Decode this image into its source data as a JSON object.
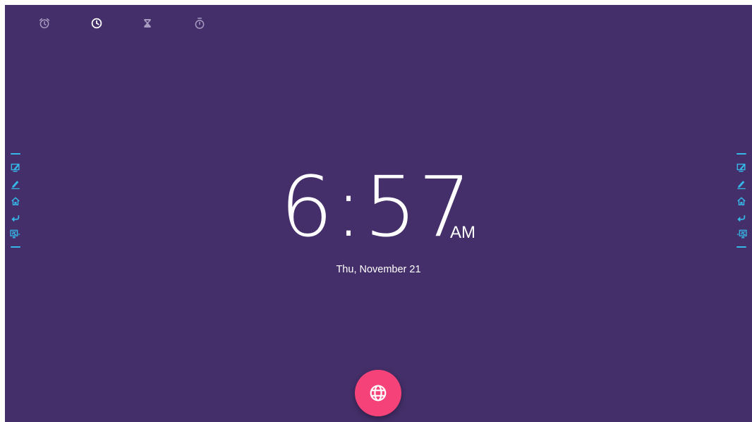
{
  "app": {
    "name": "Clock",
    "background_color": "#442f6a",
    "accent_color": "#f5437a",
    "side_icon_color": "#35b8e8"
  },
  "tabs": [
    {
      "icon": "alarm-icon",
      "label": "Alarm",
      "selected": false
    },
    {
      "icon": "clock-icon",
      "label": "Clock",
      "selected": true
    },
    {
      "icon": "hourglass-icon",
      "label": "Timer",
      "selected": false
    },
    {
      "icon": "stopwatch-icon",
      "label": "Stopwatch",
      "selected": false
    }
  ],
  "clock": {
    "time": "6:57",
    "period": "AM",
    "date": "Thu, November 21"
  },
  "side_toolbar": {
    "items": [
      {
        "icon": "annotate-screen-icon"
      },
      {
        "icon": "pen-icon"
      },
      {
        "icon": "home-icon"
      },
      {
        "icon": "back-icon"
      },
      {
        "icon": "pc-source-icon"
      }
    ]
  },
  "fab": {
    "icon": "globe-icon",
    "label": "Cities"
  }
}
